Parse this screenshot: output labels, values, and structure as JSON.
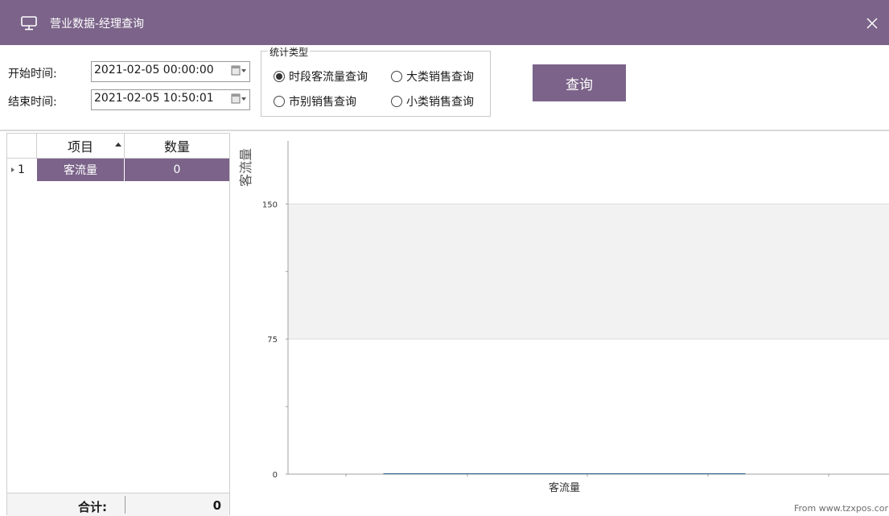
{
  "window": {
    "title": "营业数据-经理查询",
    "title_icon": "monitor-icon",
    "close_icon": "close-icon"
  },
  "filter": {
    "start_label": "开始时间:",
    "start_value": "2021-02-05 00:00:00",
    "end_label": "结束时间:",
    "end_value": "2021-02-05 10:50:01",
    "stat_group_label": "统计类型",
    "options": [
      {
        "label": "时段客流量查询",
        "checked": true
      },
      {
        "label": "大类销售查询",
        "checked": false
      },
      {
        "label": "市别销售查询",
        "checked": false
      },
      {
        "label": "小类销售查询",
        "checked": false
      }
    ],
    "query_button": "查询"
  },
  "grid": {
    "columns": [
      "项目",
      "数量"
    ],
    "sort_indicator": "ascending",
    "rows": [
      {
        "index": "1",
        "item": "客流量",
        "qty": "0"
      }
    ],
    "footer_label": "合计:",
    "footer_value": "0"
  },
  "chart_data": {
    "type": "bar",
    "categories": [
      "客流量"
    ],
    "series": [
      {
        "values": [
          0
        ]
      }
    ],
    "ylabel": "客流量",
    "xlabel": "",
    "ylim": [
      0,
      185
    ],
    "yticks": [
      0,
      75,
      150
    ],
    "grid": true
  },
  "watermark": "From www.tzxpos.cor",
  "colors": {
    "accent": "#7b6389",
    "bar": "#2f5f8a",
    "band": "#f2f2f2"
  }
}
